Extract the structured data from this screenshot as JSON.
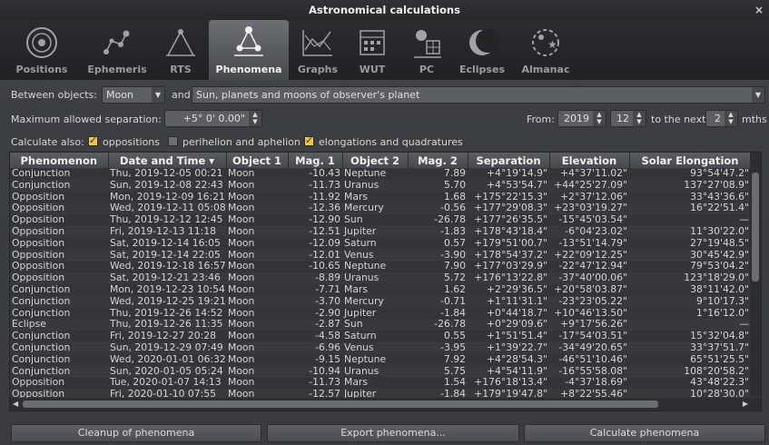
{
  "window": {
    "title": "Astronomical calculations"
  },
  "tabs": [
    {
      "label": "Positions",
      "icon": "target-icon"
    },
    {
      "label": "Ephemeris",
      "icon": "constellation-icon"
    },
    {
      "label": "RTS",
      "icon": "rts-icon"
    },
    {
      "label": "Phenomena",
      "icon": "phenomena-icon",
      "active": true
    },
    {
      "label": "Graphs",
      "icon": "graph-icon"
    },
    {
      "label": "WUT",
      "icon": "calendar-icon"
    },
    {
      "label": "PC",
      "icon": "pc-icon"
    },
    {
      "label": "Eclipses",
      "icon": "eclipse-icon"
    },
    {
      "label": "Almanac",
      "icon": "almanac-icon"
    }
  ],
  "controls": {
    "between_label": "Between objects:",
    "object1": "Moon",
    "and_label": "and",
    "object2": "Sun, planets and moons of observer's planet",
    "max_sep_label": "Maximum allowed separation:",
    "max_sep_value": "+5° 0' 0.00\"",
    "from_label": "From:",
    "from_year": "2019",
    "from_month": "12",
    "next_label": "to the next",
    "next_value": "2",
    "next_unit": "mths",
    "calc_also_label": "Calculate also:",
    "opt_oppositions": "oppositions",
    "opt_perihelion": "perihelion and aphelion",
    "opt_elongations": "elongations and quadratures"
  },
  "table": {
    "headers": [
      "Phenomenon",
      "Date and Time",
      "Object 1",
      "Mag. 1",
      "Object 2",
      "Mag. 2",
      "Separation",
      "Elevation",
      "Solar Elongation"
    ],
    "sort_indicator": "▾",
    "rows": [
      [
        "Conjunction",
        "Thu, 2019-12-05 00:21",
        "Moon",
        "-10.43",
        "Neptune",
        "7.89",
        "+4°19'14.9\"",
        "+4°37'11.02\"",
        "93°54'47.2\""
      ],
      [
        "Conjunction",
        "Sun, 2019-12-08 22:43",
        "Moon",
        "-11.73",
        "Uranus",
        "5.70",
        "+4°53'54.7\"",
        "+44°25'27.09\"",
        "137°27'08.9\""
      ],
      [
        "Opposition",
        "Mon, 2019-12-09 16:21",
        "Moon",
        "-11.92",
        "Mars",
        "1.68",
        "+175°22'15.3\"",
        "+2°37'12.06\"",
        "33°43'36.6\""
      ],
      [
        "Opposition",
        "Wed, 2019-12-11 05:08",
        "Moon",
        "-12.36",
        "Mercury",
        "-0.56",
        "+177°29'08.3\"",
        "+23°03'19.27\"",
        "16°22'51.4\""
      ],
      [
        "Opposition",
        "Thu, 2019-12-12 12:45",
        "Moon",
        "-12.90",
        "Sun",
        "-26.78",
        "+177°26'35.5\"",
        "-15°45'03.54\"",
        "—"
      ],
      [
        "Opposition",
        "Fri, 2019-12-13 11:18",
        "Moon",
        "-12.51",
        "Jupiter",
        "-1.83",
        "+178°43'18.4\"",
        "-6°04'23.02\"",
        "11°30'22.0\""
      ],
      [
        "Opposition",
        "Sat, 2019-12-14 16:05",
        "Moon",
        "-12.09",
        "Saturn",
        "0.57",
        "+179°51'00.7\"",
        "-13°51'14.79\"",
        "27°19'48.5\""
      ],
      [
        "Opposition",
        "Sat, 2019-12-14 22:05",
        "Moon",
        "-12.01",
        "Venus",
        "-3.90",
        "+178°54'37.2\"",
        "+22°09'12.25\"",
        "30°45'42.9\""
      ],
      [
        "Opposition",
        "Wed, 2019-12-18 16:57",
        "Moon",
        "-10.65",
        "Neptune",
        "7.90",
        "+177°03'29.9\"",
        "-22°47'12.94\"",
        "79°53'04.2\""
      ],
      [
        "Opposition",
        "Sat, 2019-12-21 23:46",
        "Moon",
        "-8.89",
        "Uranus",
        "5.72",
        "+176°13'22.8\"",
        "-37°40'00.06\"",
        "123°18'29.0\""
      ],
      [
        "Conjunction",
        "Mon, 2019-12-23 10:54",
        "Moon",
        "-7.71",
        "Mars",
        "1.62",
        "+2°29'36.5\"",
        "+20°58'03.87\"",
        "38°11'42.0\""
      ],
      [
        "Conjunction",
        "Wed, 2019-12-25 19:21",
        "Moon",
        "-3.70",
        "Mercury",
        "-0.71",
        "+1°11'31.1\"",
        "-23°23'05.22\"",
        "9°10'17.3\""
      ],
      [
        "Conjunction",
        "Thu, 2019-12-26 14:52",
        "Moon",
        "-2.90",
        "Jupiter",
        "-1.84",
        "+0°44'18.7\"",
        "+10°46'13.50\"",
        "1°16'12.0\""
      ],
      [
        "Eclipse",
        "Thu, 2019-12-26 11:35",
        "Moon",
        "-2.87",
        "Sun",
        "-26.78",
        "+0°29'09.6\"",
        "+9°17'56.26\"",
        "—"
      ],
      [
        "Conjunction",
        "Fri, 2019-12-27 20:28",
        "Moon",
        "-4.58",
        "Saturn",
        "0.55",
        "+1°51'51.4\"",
        "-17°54'03.51\"",
        "15°32'04.8\""
      ],
      [
        "Conjunction",
        "Sun, 2019-12-29 07:49",
        "Moon",
        "-6.96",
        "Venus",
        "-3.95",
        "+1°39'22.7\"",
        "-34°49'20.65\"",
        "33°37'51.7\""
      ],
      [
        "Conjunction",
        "Wed, 2020-01-01 06:32",
        "Moon",
        "-9.15",
        "Neptune",
        "7.92",
        "+4°28'54.3\"",
        "-46°51'10.46\"",
        "65°51'25.5\""
      ],
      [
        "Conjunction",
        "Sun, 2020-01-05 05:24",
        "Moon",
        "-10.94",
        "Uranus",
        "5.75",
        "+4°54'11.9\"",
        "-16°55'58.08\"",
        "108°20'58.2\""
      ],
      [
        "Opposition",
        "Tue, 2020-01-07 14:13",
        "Moon",
        "-11.73",
        "Mars",
        "1.54",
        "+176°18'13.4\"",
        "-4°37'18.69\"",
        "43°48'22.3\""
      ],
      [
        "Opposition",
        "Fri, 2020-01-10 07:55",
        "Moon",
        "-12.57",
        "Jupiter",
        "-1.84",
        "+179°19'47.8\"",
        "+8°22'55.46\"",
        "10°28'30.0\""
      ]
    ]
  },
  "buttons": {
    "cleanup": "Cleanup of phenomena",
    "export": "Export phenomena...",
    "calculate": "Calculate phenomena"
  }
}
